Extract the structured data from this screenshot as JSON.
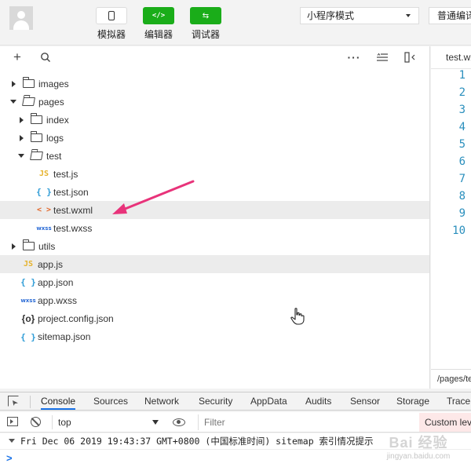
{
  "toolbar": {
    "simulator": "模拟器",
    "editor": "编辑器",
    "debugger": "调试器",
    "mode": "小程序模式",
    "compile": "普通编译"
  },
  "explorer": {
    "tree": [
      {
        "label": "images",
        "type": "folder",
        "state": "closed",
        "depth": 0
      },
      {
        "label": "pages",
        "type": "folder",
        "state": "open",
        "depth": 0
      },
      {
        "label": "index",
        "type": "folder",
        "state": "closed",
        "depth": 1
      },
      {
        "label": "logs",
        "type": "folder",
        "state": "closed",
        "depth": 1
      },
      {
        "label": "test",
        "type": "folder",
        "state": "open",
        "depth": 1
      },
      {
        "label": "test.js",
        "type": "js",
        "depth": 2
      },
      {
        "label": "test.json",
        "type": "json",
        "depth": 2
      },
      {
        "label": "test.wxml",
        "type": "wxml",
        "depth": 2,
        "selected": true
      },
      {
        "label": "test.wxss",
        "type": "wxss",
        "depth": 2
      },
      {
        "label": "utils",
        "type": "folder",
        "state": "closed",
        "depth": 0
      },
      {
        "label": "app.js",
        "type": "js",
        "depth": 0,
        "hover": true
      },
      {
        "label": "app.json",
        "type": "json",
        "depth": 0
      },
      {
        "label": "app.wxss",
        "type": "wxss",
        "depth": 0
      },
      {
        "label": "project.config.json",
        "type": "config",
        "depth": 0
      },
      {
        "label": "sitemap.json",
        "type": "json",
        "depth": 0
      }
    ]
  },
  "icons": {
    "js": "JS",
    "json": "{ }",
    "wxml": "< >",
    "wxss": "wxss",
    "config": "{o}"
  },
  "editor": {
    "tab": "test.wxml",
    "path": "/pages/test/test.wxml",
    "line_numbers": [
      "1",
      "2",
      "3",
      "4",
      "5",
      "6",
      "7",
      "8",
      "9",
      "10"
    ]
  },
  "devtools": {
    "tabs": [
      "Console",
      "Sources",
      "Network",
      "Security",
      "AppData",
      "Audits",
      "Sensor",
      "Storage",
      "Trace"
    ],
    "active_tab": "Console",
    "context": "top",
    "filter_placeholder": "Filter",
    "level": "Custom levels",
    "log": "Fri Dec 06 2019 19:43:37 GMT+0800 (中国标准时间) sitemap 索引情况提示",
    "prompt": ">"
  },
  "watermark": {
    "brand": "Bai 经验",
    "url": "jingyan.baidu.com"
  },
  "colors": {
    "accent_green": "#1aad19",
    "line_number_blue": "#2a8fbd",
    "annotation_arrow": "#e8337a"
  }
}
